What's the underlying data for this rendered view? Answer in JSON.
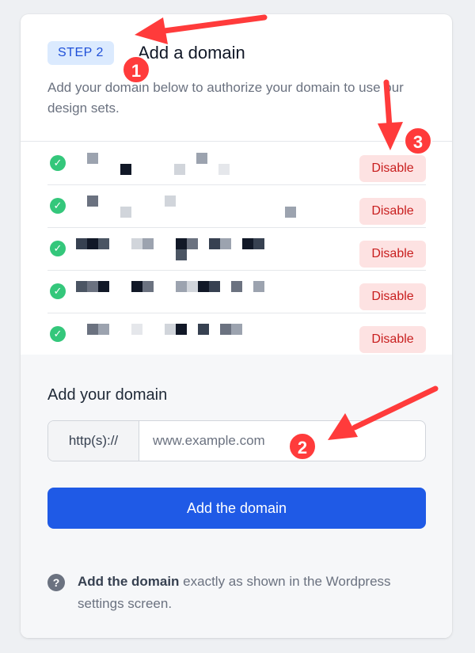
{
  "header": {
    "step_badge": "STEP 2",
    "title": "Add a domain",
    "description": "Add your domain below to authorize your domain to use our design sets."
  },
  "domains": {
    "rows": [
      {
        "status": "verified",
        "action_label": "Disable"
      },
      {
        "status": "verified",
        "action_label": "Disable"
      },
      {
        "status": "verified",
        "action_label": "Disable"
      },
      {
        "status": "verified",
        "action_label": "Disable"
      },
      {
        "status": "verified",
        "action_label": "Disable"
      }
    ]
  },
  "add_form": {
    "label": "Add your domain",
    "prefix": "http(s)://",
    "placeholder": "www.example.com",
    "value": "",
    "submit_label": "Add the domain"
  },
  "help": {
    "strong": "Add the domain",
    "text": " exactly as shown in the Wordpress settings screen."
  },
  "annotations": {
    "markers": [
      "1",
      "2",
      "3"
    ],
    "color": "#ff3b3b"
  },
  "colors": {
    "primary": "#1f5ae6",
    "success": "#34c77b",
    "danger": "#c81e1e",
    "danger_bg": "#fde2e2",
    "badge_bg": "#dbeafe"
  }
}
